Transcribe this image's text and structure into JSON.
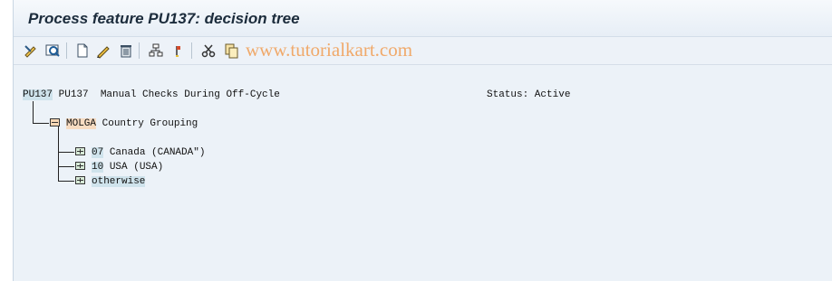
{
  "window": {
    "title": "Process feature PU137: decision tree"
  },
  "watermark": "www.tutorialkart.com",
  "toolbar": {
    "icons": [
      "edit-icon",
      "display-icon",
      "create-icon",
      "change-icon",
      "delete-icon",
      "structure-icon",
      "flag-icon",
      "cut-icon",
      "copy-icon"
    ]
  },
  "tree": {
    "root": {
      "key": "PU137",
      "text": "PU137  Manual Checks During Off-Cycle",
      "status": "Status: Active"
    },
    "level1": {
      "key": "MOLGA",
      "text": "Country Grouping"
    },
    "children": [
      {
        "key": "07",
        "text": "Canada (CANADA\")"
      },
      {
        "key": "10",
        "text": "USA (USA)"
      },
      {
        "key": "otherwise",
        "text": ""
      }
    ]
  },
  "colors": {
    "background": "#ecf2f8",
    "highlight_blue": "#cfe3ec",
    "highlight_orange": "#f7dcc2"
  }
}
